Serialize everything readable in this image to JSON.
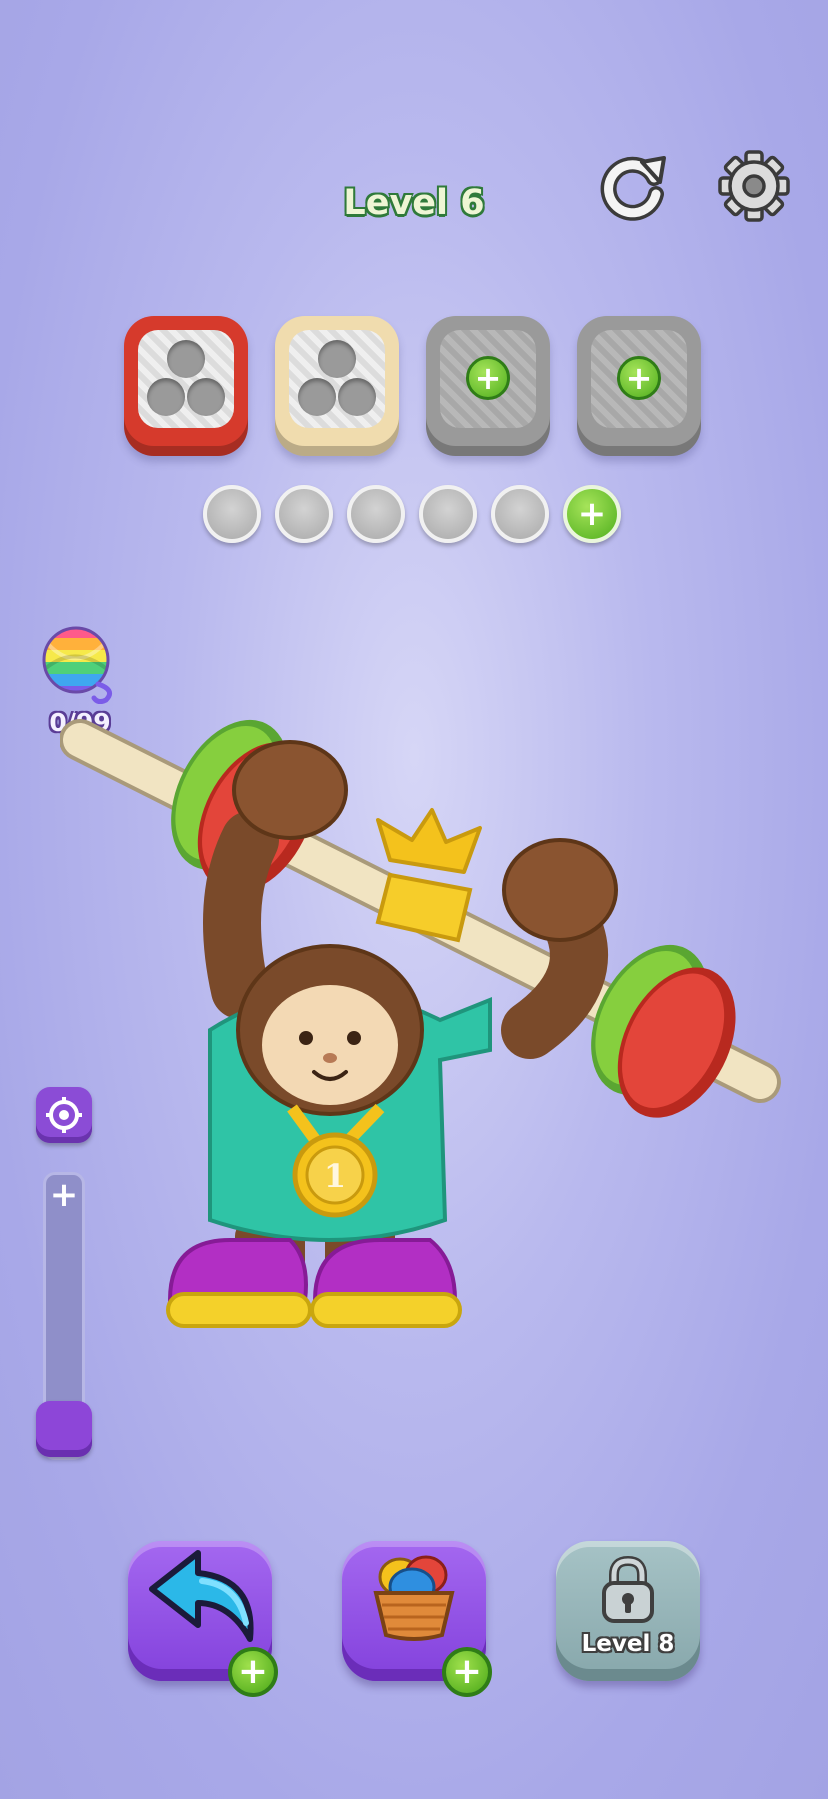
{
  "header": {
    "level_title": "Level 6",
    "restart_icon": "restart-icon",
    "settings_icon": "gear-icon"
  },
  "boxes": [
    {
      "color": "#d63a2c",
      "state": "filled-holes",
      "holes": 3
    },
    {
      "color": "#f0dcae",
      "state": "filled-holes",
      "holes": 3
    },
    {
      "color": "#9a9a9a",
      "state": "locked",
      "action": "add"
    },
    {
      "color": "#9a9a9a",
      "state": "locked",
      "action": "add"
    }
  ],
  "slots": {
    "empty": 5,
    "add_button": "plus-icon"
  },
  "yarn": {
    "counter": "0/99",
    "icon": "yarn-ball-icon"
  },
  "zoom": {
    "target_icon": "target-icon",
    "plus": "+",
    "level": 0
  },
  "bottom": {
    "undo_icon": "undo-arrow-icon",
    "basket_icon": "yarn-basket-icon",
    "locked_label": "Level 8",
    "lock_icon": "padlock-icon",
    "plus": "+"
  },
  "colors": {
    "background": "#acace8",
    "level_text_outline": "#2f7a3a",
    "button_purple": "#8f4fe0",
    "button_locked": "#94b3b7",
    "plus_green": "#5cbb25"
  }
}
